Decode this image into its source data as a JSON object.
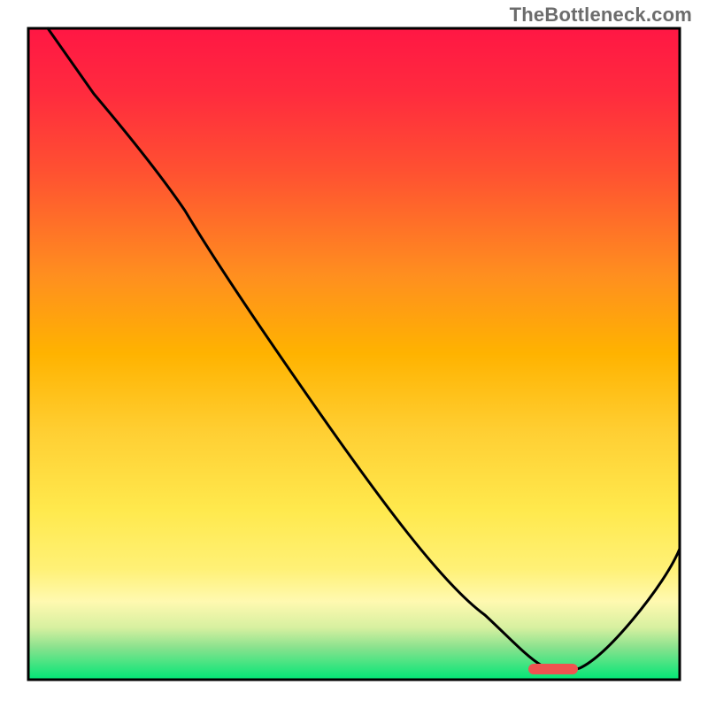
{
  "watermark": "TheBottleneck.com",
  "chart_data": {
    "type": "line",
    "title": "",
    "xlabel": "",
    "ylabel": "",
    "xlim": [
      0,
      100
    ],
    "ylim": [
      0,
      100
    ],
    "grid": false,
    "legend": false,
    "gradient_bands": [
      {
        "color": "#ff1744",
        "position": 0
      },
      {
        "color": "#ff5131",
        "position": 25
      },
      {
        "color": "#ffc107",
        "position": 50
      },
      {
        "color": "#fff176",
        "position": 75
      },
      {
        "color": "#fff9c4",
        "position": 86
      },
      {
        "color": "#c5e1a5",
        "position": 92
      },
      {
        "color": "#00e676",
        "position": 100
      }
    ],
    "series": [
      {
        "name": "bottleneck-curve",
        "x": [
          3,
          10,
          20,
          24,
          30,
          40,
          50,
          60,
          70,
          74,
          78,
          82,
          86,
          90,
          95,
          100
        ],
        "y": [
          100,
          90,
          77,
          72,
          63,
          49,
          36,
          23,
          10,
          5,
          2,
          1,
          3,
          7,
          14,
          22
        ]
      }
    ],
    "marker": {
      "name": "optimal-point",
      "x": 80,
      "y": 1.5,
      "width": 6,
      "height": 1.5,
      "color": "#ef5350"
    }
  }
}
